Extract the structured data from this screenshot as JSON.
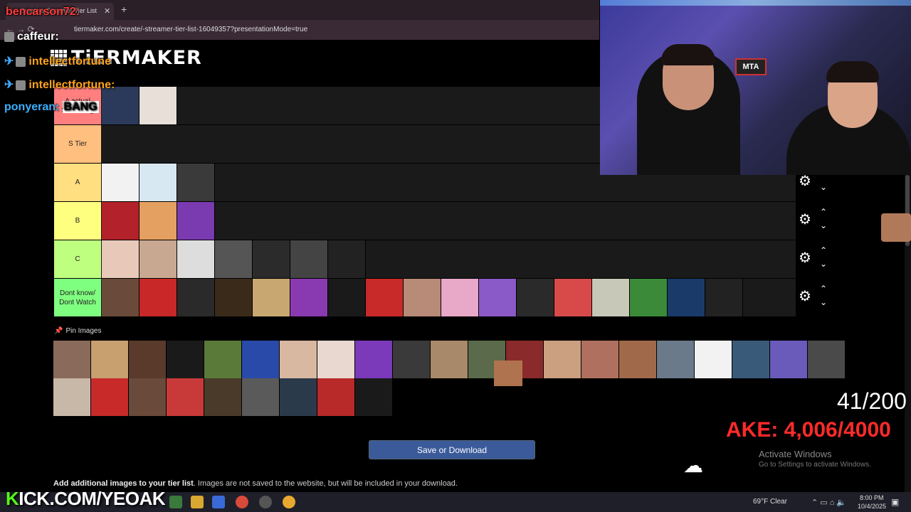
{
  "browser": {
    "tab_title": "Create a Streamer Tier List",
    "tab_close": "✕",
    "new_tab": "+",
    "nav_icons": "← → ⟳",
    "url": "tiermaker.com/create/-streamer-tier-list-16049357?presentationMode=true"
  },
  "logo": {
    "text": "TiERMAKER"
  },
  "tiers": [
    {
      "label": "A actual Streaming",
      "color": "#ff7f7f",
      "item_count": 2,
      "colors": [
        "#2b3a5a",
        "#e8e0d8"
      ]
    },
    {
      "label": "S Tier",
      "color": "#ffbf7f",
      "item_count": 0,
      "colors": []
    },
    {
      "label": "A",
      "color": "#ffdf7f",
      "item_count": 3,
      "colors": [
        "#f2f2f2",
        "#d8e8f2",
        "#3a3a3a"
      ]
    },
    {
      "label": "B",
      "color": "#ffff7f",
      "item_count": 3,
      "colors": [
        "#b3222a",
        "#e3a060",
        "#7a3ab0"
      ]
    },
    {
      "label": "C",
      "color": "#bfff7f",
      "item_count": 7,
      "colors": [
        "#e8c8b8",
        "#c8a890",
        "#ddd",
        "#555",
        "#2b2b2b",
        "#444",
        "#222"
      ]
    },
    {
      "label": "Dont know/ Dont Watch",
      "color": "#7fff7f",
      "item_count": 16,
      "colors": [
        "#6a4a3a",
        "#c82828",
        "#2a2a2a",
        "#3a2a1a",
        "#c8a870",
        "#8a3ab0",
        "#1a1a1a",
        "#c82a2a",
        "#b88a78",
        "#e8a8c8",
        "#8a5ac8",
        "#2a2a2a",
        "#d84a4a",
        "#c8c8b8",
        "#3a8a3a",
        "#1a3a6a",
        "#222"
      ]
    }
  ],
  "controls": {
    "gear": "⚙",
    "up": "⌃",
    "down": "⌄"
  },
  "pin_images": {
    "label": "Pin Images",
    "row1": [
      "#8a6a5a",
      "#c8a070",
      "#5a3a2a",
      "#1a1a1a",
      "#5a7a3a",
      "#2a4aaa",
      "#d8b8a0",
      "#e8d8d0",
      "#7a3aba",
      "#3a3a3a",
      "#a88a6a",
      "#5a6a4a",
      "#8a2a2a",
      "#caa080",
      "#b07060",
      "#a06a4a",
      "#6a7a8a",
      "#f2f2f2",
      "#3a5a7a",
      "#6a5aba",
      "#4a4a4a"
    ],
    "row2": [
      "#c8b8a8",
      "#c82a2a",
      "#6a4a3a",
      "#c83a3a",
      "#4a3a2a",
      "#5a5a5a",
      "#2a3a4a",
      "#b82a2a",
      "#1a1a1a"
    ]
  },
  "save_button": "Save or Download",
  "add_text_bold": "Add additional images to your tier list",
  "add_text_rest": ". Images are not saved to the website, but will be included in your download.",
  "chat": [
    {
      "user": "bencarson72:",
      "color": "#ff3b3b"
    },
    {
      "user": "caffeur:",
      "color": "#ffffff"
    },
    {
      "user": "intellectfortune",
      "color": "#ffa31a"
    },
    {
      "user": "intellectfortune:",
      "color": "#ffa31a"
    },
    {
      "user": "ponyeran:",
      "color": "#3ab0ff",
      "message": "BANG"
    }
  ],
  "overlay": {
    "counter": "41/200",
    "goal": "AKE: 4,006/4000",
    "activate_title": "Activate Windows",
    "activate_sub": "Go to Settings to activate Windows.",
    "kick": "KICK.COM/YEOAK",
    "kick_k": "K",
    "mta": "MTA"
  },
  "taskbar": {
    "weather": "69°F  Clear",
    "tray": "⌃  ▭  ⌂  🔈",
    "time": "8:00 PM",
    "date": "10/4/2025",
    "notif": "▣"
  }
}
